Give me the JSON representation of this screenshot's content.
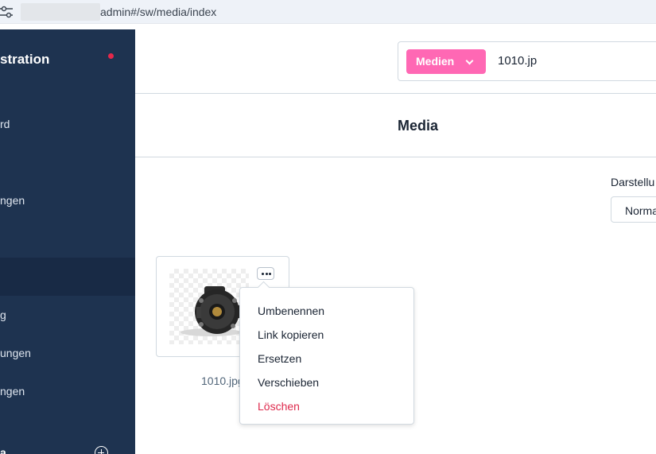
{
  "browser": {
    "url": "admin#/sw/media/index"
  },
  "sidebar": {
    "title": "stration",
    "items": [
      {
        "label": "rd"
      },
      {
        "label": "ngen"
      },
      {
        "label": ""
      },
      {
        "label": "g"
      },
      {
        "label": "ungen"
      },
      {
        "label": "ngen"
      }
    ],
    "bottom_label": "a"
  },
  "search": {
    "type_label": "Medien",
    "value": "1010.jp"
  },
  "page": {
    "title": "Media"
  },
  "view": {
    "label": "Darstellu",
    "selected": "Norma"
  },
  "media": {
    "filename": "1010.jpg"
  },
  "context_menu": {
    "items": [
      {
        "label": "Umbenennen"
      },
      {
        "label": "Link kopieren"
      },
      {
        "label": "Ersetzen"
      },
      {
        "label": "Verschieben"
      },
      {
        "label": "Löschen"
      }
    ]
  },
  "colors": {
    "sidebar_bg": "#1e3350",
    "accent_pink": "#ff68b4",
    "danger": "#de294c",
    "notification_dot": "#e5284a"
  }
}
